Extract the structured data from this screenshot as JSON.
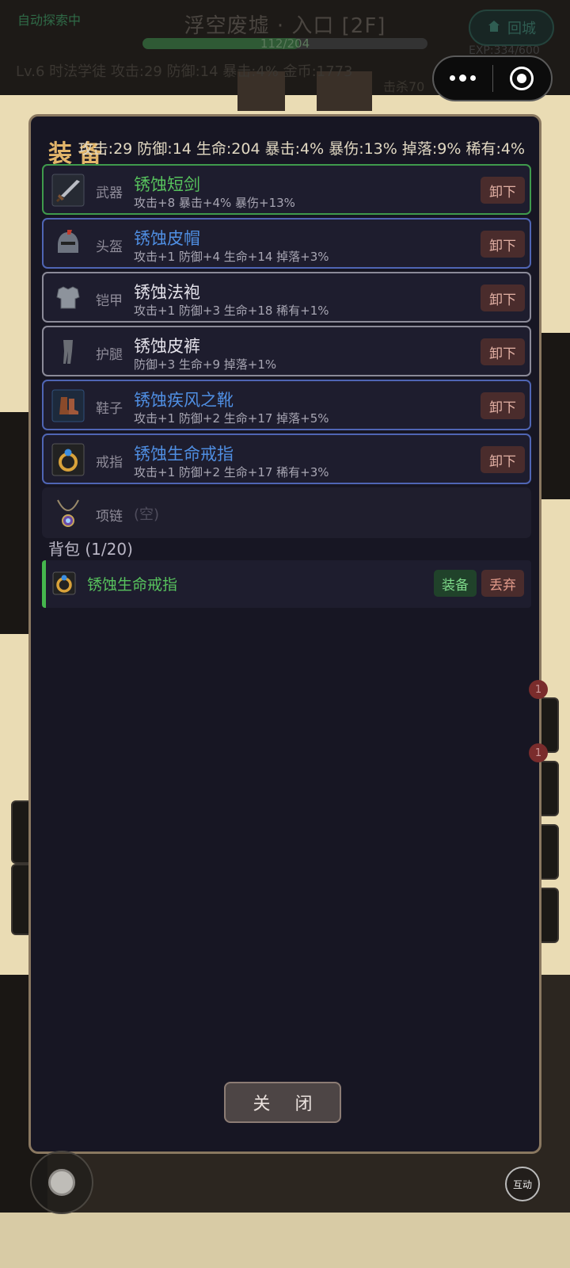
{
  "hud": {
    "auto_explore": "自动探索中",
    "location": "浮空废墟 · 入口 [2F]",
    "hp_text": "112/204",
    "hp_fraction": 0.549,
    "stats_line": "Lv.6 时法学徒   攻击:29   防御:14   暴击:4%   金币:1773",
    "town_button": "回城",
    "exp": "EXP:334/600",
    "kills": "击杀70"
  },
  "equipment_panel": {
    "title": "装备",
    "stats_summary": "攻击:29  防御:14  生命:204  暴击:4%  暴伤:13%  掉落:9%  稀有:4%",
    "unequip_label": "卸下",
    "slots": [
      {
        "slot": "武器",
        "name": "锈蚀短剑",
        "stats": "攻击+8 暴击+4% 暴伤+13%",
        "rarity": "green",
        "icon": "sword-icon"
      },
      {
        "slot": "头盔",
        "name": "锈蚀皮帽",
        "stats": "攻击+1 防御+4 生命+14 掉落+3%",
        "rarity": "blue",
        "icon": "helmet-icon"
      },
      {
        "slot": "铠甲",
        "name": "锈蚀法袍",
        "stats": "攻击+1 防御+3 生命+18 稀有+1%",
        "rarity": "white",
        "icon": "armor-icon"
      },
      {
        "slot": "护腿",
        "name": "锈蚀皮裤",
        "stats": "防御+3 生命+9 掉落+1%",
        "rarity": "white",
        "icon": "leggings-icon"
      },
      {
        "slot": "鞋子",
        "name": "锈蚀疾风之靴",
        "stats": "攻击+1 防御+2 生命+17 掉落+5%",
        "rarity": "blue",
        "icon": "boots-icon"
      },
      {
        "slot": "戒指",
        "name": "锈蚀生命戒指",
        "stats": "攻击+1 防御+2 生命+17 稀有+3%",
        "rarity": "blue",
        "icon": "ring-icon"
      },
      {
        "slot": "项链",
        "name": "(空)",
        "stats": "",
        "rarity": "empty",
        "icon": "necklace-icon"
      }
    ],
    "bag": {
      "title": "背包 (1/20)",
      "items": [
        {
          "name": "锈蚀生命戒指",
          "equip_label": "装备",
          "drop_label": "丢弃",
          "icon": "ring-icon"
        }
      ]
    },
    "close_label": "关 闭"
  },
  "controls": {
    "interact_label": "互动"
  },
  "badges": [
    "1",
    "1"
  ],
  "colors": {
    "rarity_green": "#57c25d",
    "rarity_blue": "#4f8ee2",
    "rarity_white": "#e4e2ea",
    "title_gold": "#e2b56a",
    "modal_border": "#8a7860"
  }
}
